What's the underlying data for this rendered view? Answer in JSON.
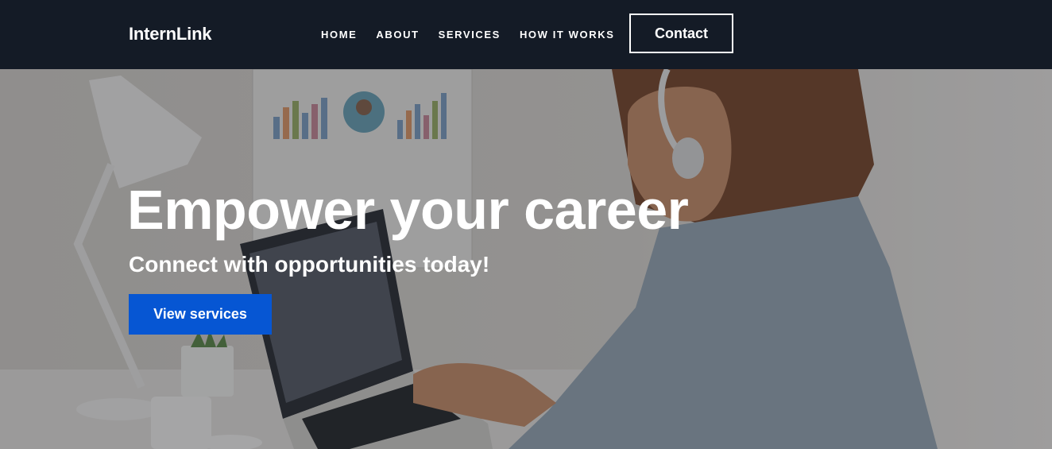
{
  "nav": {
    "brand": "InternLink",
    "links": [
      "HOME",
      "ABOUT",
      "SERVICES",
      "HOW IT WORKS"
    ],
    "contact_label": "Contact"
  },
  "hero": {
    "title": "Empower your career",
    "subtitle": "Connect with opportunities today!",
    "cta_label": "View services",
    "background_image": "woman-with-headphones-using-laptop-photo"
  },
  "colors": {
    "nav_bg": "#141b26",
    "cta_bg": "#0656d3",
    "text": "#ffffff"
  }
}
